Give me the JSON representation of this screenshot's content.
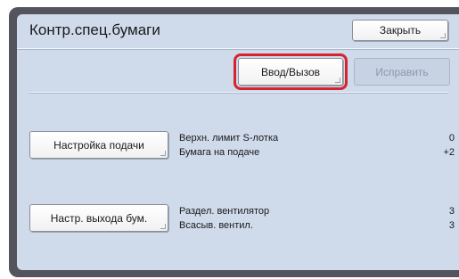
{
  "header": {
    "title": "Контр.спец.бумаги",
    "close_label": "Закрыть"
  },
  "toolbar": {
    "enter_call_label": "Ввод/Вызов",
    "edit_label": "Исправить"
  },
  "sections": [
    {
      "button_label": "Настройка подачи",
      "rows": [
        {
          "label": "Верхн. лимит S-лотка",
          "value": "0"
        },
        {
          "label": "Бумага на подаче",
          "value": "+2"
        }
      ]
    },
    {
      "button_label": "Настр. выхода бум.",
      "rows": [
        {
          "label": "Раздел. вентилятор",
          "value": "3"
        },
        {
          "label": "Всасыв. вентил.",
          "value": "3"
        }
      ]
    }
  ],
  "colors": {
    "panel": "#cfdaeb",
    "frame": "#54545c",
    "highlight": "#d5242e"
  }
}
